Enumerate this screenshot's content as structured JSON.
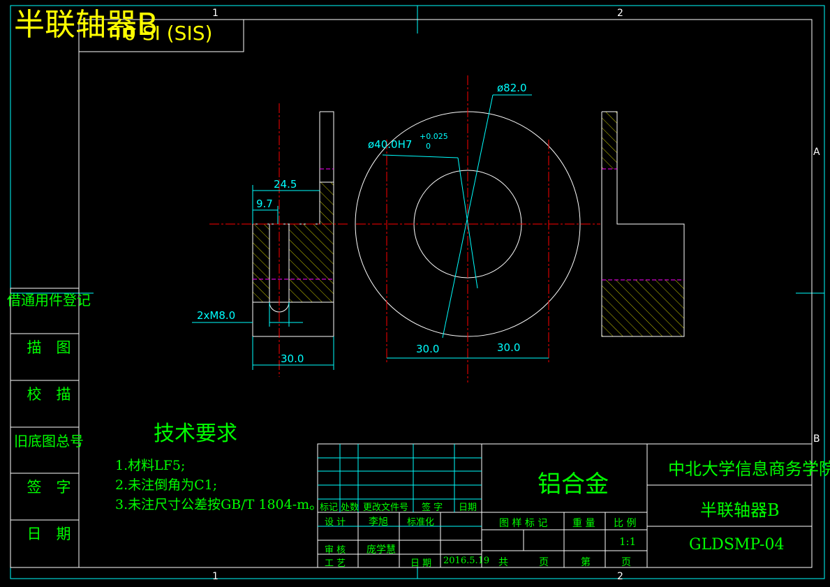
{
  "drawing": {
    "part_title": "半联轴器B",
    "overlap_text": "T0 SI (SIS)",
    "zone_numbers": [
      "1",
      "2",
      "1",
      "2"
    ],
    "zone_letters": [
      "A",
      "B"
    ]
  },
  "side_column": {
    "labels": [
      "借通用件登记",
      "描　图",
      "校　描",
      "旧底图总号",
      "签　字",
      "日　期"
    ]
  },
  "dimensions": {
    "width_24_5": "24.5",
    "width_9_7": "9.7",
    "thread": "2xM8.0",
    "width_30_left": "30.0",
    "bore": "ø40.0H7",
    "bore_tol_upper": "+0.025",
    "bore_tol_lower": "0",
    "outer_dia": "ø82.0",
    "half_left": "30.0",
    "half_right": "30.0"
  },
  "tech_requirements": {
    "title": "技术要求",
    "notes": [
      "1.材料LF5;",
      "2.未注倒角为C1;",
      "3.未注尺寸公差按GB/T 1804-m。"
    ]
  },
  "title_block": {
    "material": "铝合金",
    "school": "中北大学信息商务学院",
    "part_name": "半联轴器B",
    "drawing_code": "GLDSMP-04",
    "rev_headers": [
      "标记",
      "处数",
      "更改文件号",
      "签 字",
      "日期"
    ],
    "designer_label": "设 计",
    "designer": "李旭",
    "standard_label": "标准化",
    "checker_label": "审 核",
    "checker": "庞学慧",
    "process_label": "工 艺",
    "date_label": "日 期",
    "date": "2016.5.19",
    "stage_label": "图 样 标 记",
    "weight_label": "重 量",
    "scale_label": "比 例",
    "scale": "1:1",
    "total_label": "共",
    "page_label": "页",
    "sheet_label": "第",
    "page_label2": "页"
  },
  "colors": {
    "frame": "#ffffff",
    "cyan": "#00ffff",
    "center": "#ff0000",
    "hatch": "#ffff00",
    "hidden": "#ff00ff",
    "text": "#00ff00"
  }
}
